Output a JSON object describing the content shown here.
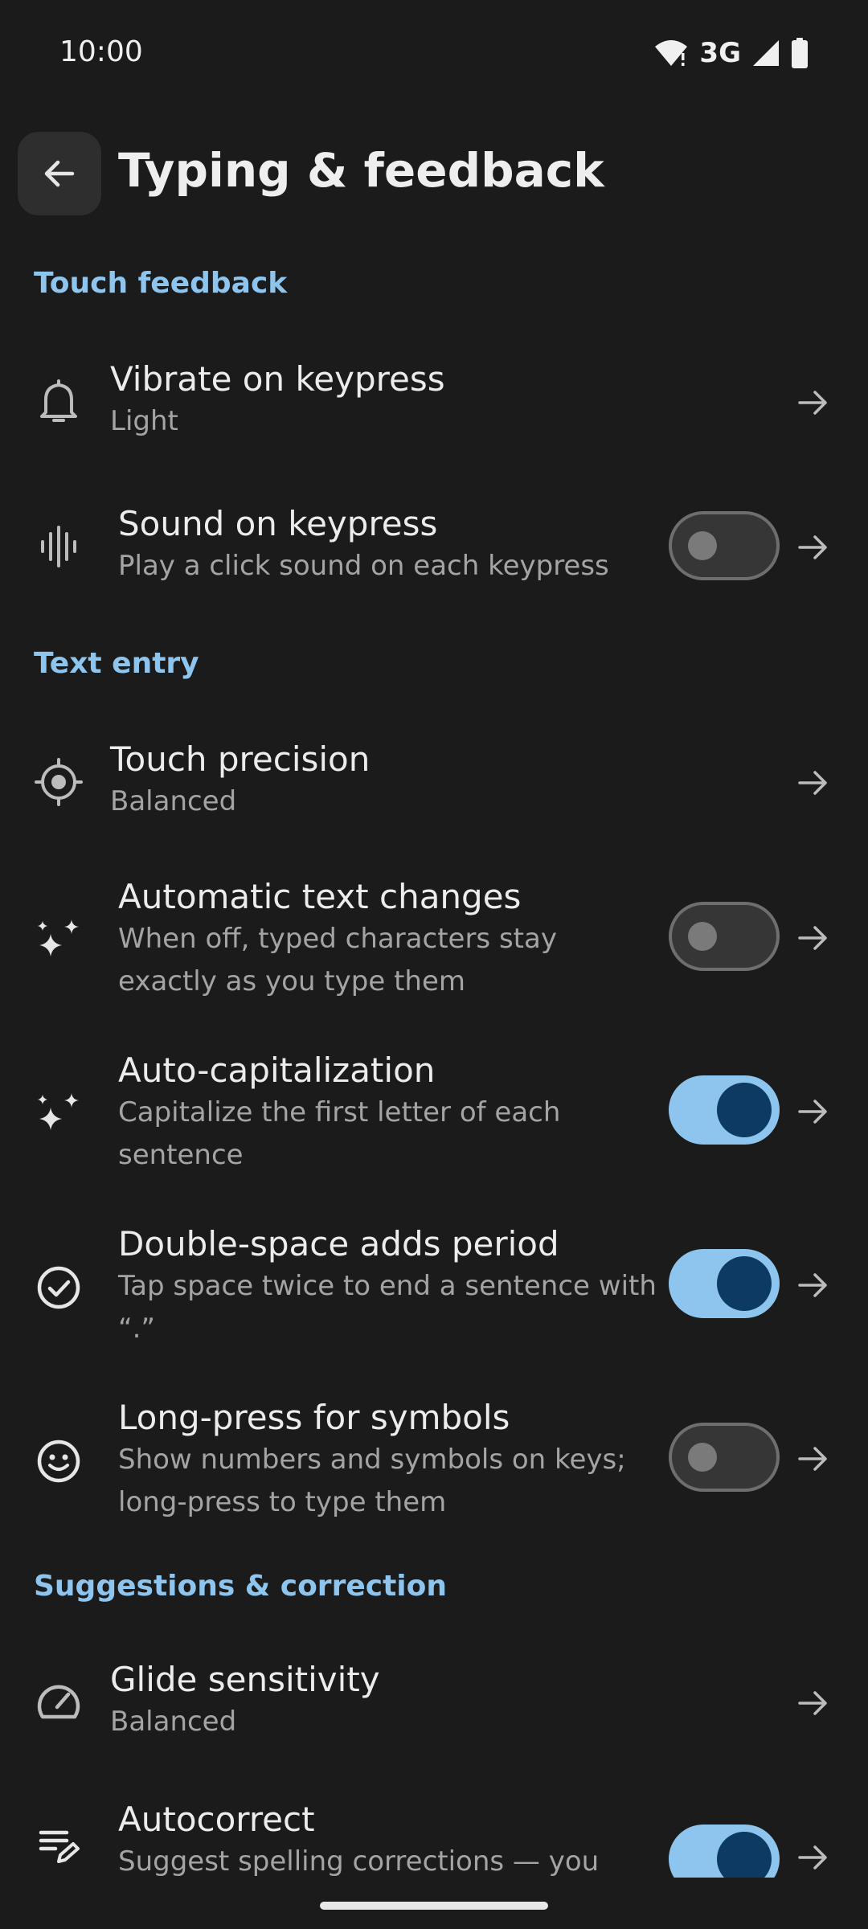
{
  "status_bar": {
    "time": "10:00",
    "network": "3G",
    "icons": [
      "wifi-icon",
      "signal-icon",
      "battery-icon"
    ]
  },
  "app_bar": {
    "title": "Typing & feedback",
    "back_icon": "arrow-left-icon"
  },
  "colors": {
    "background": "#1b1b1b",
    "accent": "#8ec5ee",
    "toggle_on_knob": "#0c3a63"
  },
  "sections": [
    {
      "header": "Touch feedback",
      "items": [
        {
          "icon": "bell-icon",
          "title": "Vibrate on keypress",
          "subtitle": "Light"
        },
        {
          "icon": "sound-wave-icon",
          "title": "Sound on keypress",
          "subtitle": "Play a click sound on each keypress",
          "toggle": "off"
        }
      ]
    },
    {
      "header": "Text entry",
      "items": [
        {
          "icon": "crosshair-icon",
          "title": "Touch precision",
          "subtitle": "Balanced"
        },
        {
          "icon": "sparkle-icon",
          "title": "Automatic text changes",
          "subtitle": "When off, typed characters stay exactly as you type them",
          "toggle": "off"
        },
        {
          "icon": "sparkle-icon",
          "title": "Auto-capitalization",
          "subtitle": "Capitalize the first letter of each sentence",
          "toggle": "on"
        },
        {
          "icon": "check-circle-icon",
          "title": "Double-space adds period",
          "subtitle": "Tap space twice to end a sentence with “.”",
          "toggle": "on"
        },
        {
          "icon": "smiley-icon",
          "title": "Long-press for symbols",
          "subtitle": "Show numbers and symbols on keys; long-press to type them",
          "toggle": "off"
        }
      ]
    },
    {
      "header": "Suggestions & correction",
      "items": [
        {
          "icon": "gauge-icon",
          "title": "Glide sensitivity",
          "subtitle": "Balanced"
        },
        {
          "icon": "edit-list-icon",
          "title": "Autocorrect",
          "subtitle": "Suggest spelling corrections — you",
          "toggle": "on"
        }
      ]
    }
  ]
}
